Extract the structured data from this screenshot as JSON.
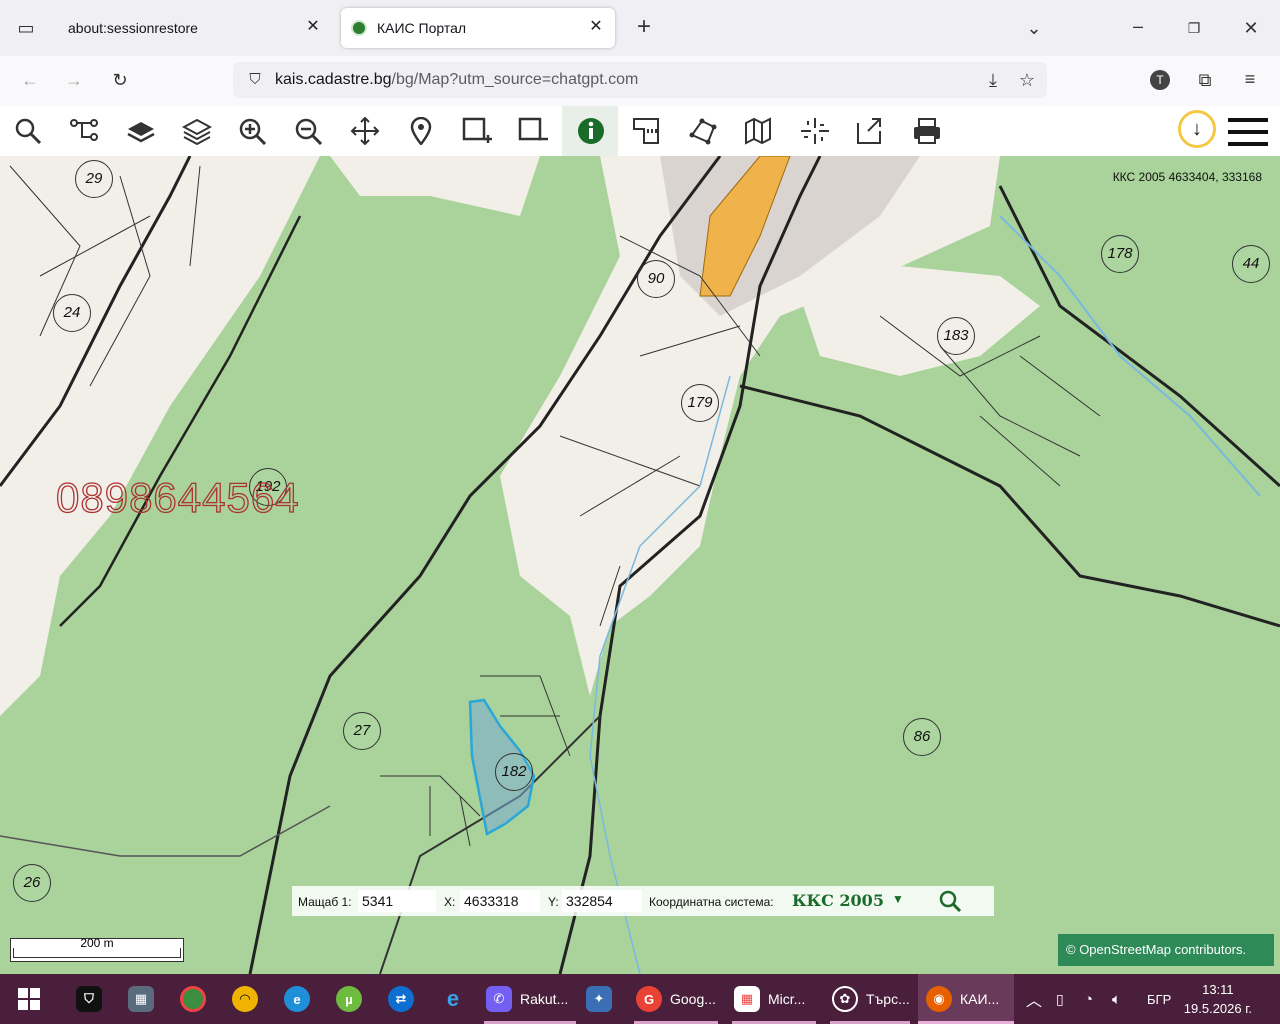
{
  "browser": {
    "tabs": [
      {
        "label": "about:sessionrestore"
      },
      {
        "label": "КАИС Портал"
      }
    ],
    "url_host": "kais.cadastre.bg",
    "url_rest": "/bg/Map?utm_source=chatgpt.com"
  },
  "map": {
    "coordinates_readout": "ККС 2005 4633404, 333168",
    "watermark_phone": "0898644564",
    "parcels": [
      "29",
      "24",
      "90",
      "178",
      "44",
      "183",
      "179",
      "192",
      "27",
      "182",
      "86",
      "26"
    ],
    "scale_form": {
      "scale_label": "Мащаб 1:",
      "scale_value": "5341",
      "x_label": "X:",
      "x_value": "4633318",
      "y_label": "Y:",
      "y_value": "332854",
      "crs_label": "Координатна система:",
      "crs_value": "ККС 2005"
    },
    "scale_bar": "200 m",
    "attribution": "© OpenStreetMap contributors."
  },
  "taskbar": {
    "apps": [
      {
        "label": "Rakut..."
      },
      {
        "label": "Goog..."
      },
      {
        "label": "Micr..."
      },
      {
        "label": "Търс..."
      },
      {
        "label": "КАИ..."
      }
    ],
    "language": "БГР",
    "time": "13:11",
    "date": "19.5.2026 г."
  },
  "colors": {
    "forest": "#a9d39a",
    "accent_green": "#1a6b2a",
    "taskbar": "#4a1f3b",
    "selected_parcel": "#2aa7d8"
  }
}
